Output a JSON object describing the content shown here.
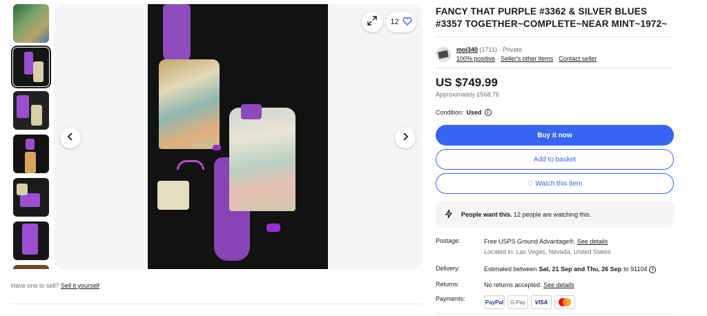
{
  "gallery": {
    "watch_count": "12",
    "prev_icon": "chevron-left-icon",
    "next_icon": "chevron-right-icon",
    "expand_icon": "expand-icon",
    "heart_icon": "heart-icon",
    "selected_thumbnail": 2
  },
  "sell": {
    "prompt": "Have one to sell?",
    "link": "Sell it yourself"
  },
  "listing": {
    "title": "FANCY THAT PURPLE #3362 & SILVER BLUES #3357 TOGETHER~COMPLETE~NEAR MINT~1972~"
  },
  "seller": {
    "name": "moi340",
    "feedback_count": "(1711)",
    "type": "· Private",
    "positive": "100% positive",
    "other_items": "Seller's other items",
    "contact": "Contact seller"
  },
  "price": {
    "main": "US $749.99",
    "approx": "Approximately £568.76"
  },
  "condition": {
    "label": "Condition:",
    "value": "Used"
  },
  "buttons": {
    "buy_now": "Buy it now",
    "add_to_basket": "Add to basket",
    "watch": "♡ Watch this item"
  },
  "alert": {
    "bold": "People want this.",
    "text": "12 people are watching this."
  },
  "details": {
    "postage_label": "Postage:",
    "postage_value": "Free USPS Ground Advantage®.",
    "postage_link": "See details",
    "location": "Located in: Las Vegas, Nevada, United States",
    "delivery_label": "Delivery:",
    "delivery_prefix": "Estimated between",
    "delivery_dates": "Sat, 21 Sep and Thu, 26 Sep",
    "delivery_suffix": "to 91104",
    "returns_label": "Returns:",
    "returns_value": "No returns accepted.",
    "returns_link": "See details",
    "payments_label": "Payments:",
    "payment_methods": [
      "PayPal",
      "G Pay",
      "VISA",
      "mastercard"
    ]
  },
  "colors": {
    "accent": "#3665f3",
    "text": "#191919",
    "muted": "#707070"
  }
}
